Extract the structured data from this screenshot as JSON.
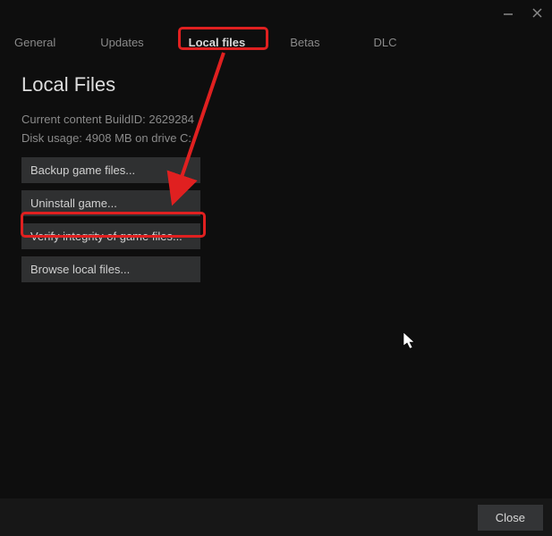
{
  "titlebar": {
    "minimize": "—",
    "close": "✕"
  },
  "tabs": {
    "general": "General",
    "updates": "Updates",
    "local_files": "Local files",
    "betas": "Betas",
    "dlc": "DLC"
  },
  "section": {
    "title": "Local Files",
    "build_info": "Current content BuildID: 2629284",
    "disk_info": "Disk usage: 4908 MB on drive C:"
  },
  "actions": {
    "backup": "Backup game files...",
    "uninstall": "Uninstall game...",
    "verify": "Verify integrity of game files...",
    "browse": "Browse local files..."
  },
  "footer": {
    "close": "Close"
  },
  "annotation": {
    "arrow_color": "#e02020"
  }
}
